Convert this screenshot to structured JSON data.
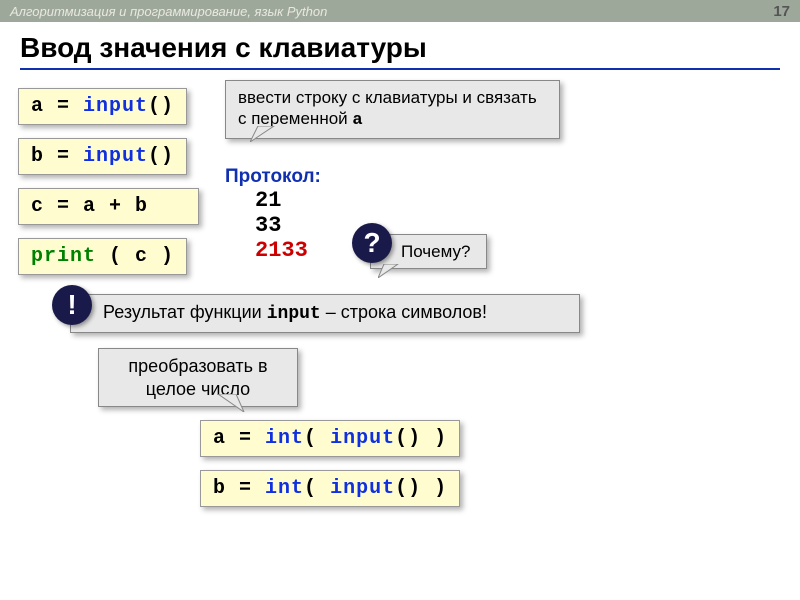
{
  "header": {
    "course": "Алгоритмизация и программирование, язык Python",
    "page": "17"
  },
  "title": "Ввод значения с клавиатуры",
  "code": {
    "l1": {
      "lhs": "a",
      "eq": " = ",
      "fn": "input",
      "rhs": "()"
    },
    "l2": {
      "lhs": "b",
      "eq": " = ",
      "fn": "input",
      "rhs": "()"
    },
    "l3": {
      "lhs": "c",
      "eq": " = ",
      "rhs": "a + b"
    },
    "l4": {
      "fn": "print",
      "rhs": " ( c )"
    }
  },
  "callout1": {
    "text": "ввести строку с клавиатуры и связать с переменной ",
    "var": "a"
  },
  "protocol": {
    "label": "Протокол:",
    "v1": "21",
    "v2": "33",
    "v3": "2133"
  },
  "callout_why": "Почему?",
  "q_symbol": "?",
  "e_symbol": "!",
  "callout_result": {
    "p1": "Результат функции ",
    "mono": "input",
    "p2": " – строка символов!"
  },
  "callout_convert": "преобразовать в целое число",
  "code2": {
    "l1": {
      "lhs": "a",
      "eq": " = ",
      "fn1": "int",
      "p1": "( ",
      "fn2": "input",
      "p2": "() )"
    },
    "l2": {
      "lhs": "b",
      "eq": " = ",
      "fn1": "int",
      "p1": "( ",
      "fn2": "input",
      "p2": "() )"
    }
  }
}
